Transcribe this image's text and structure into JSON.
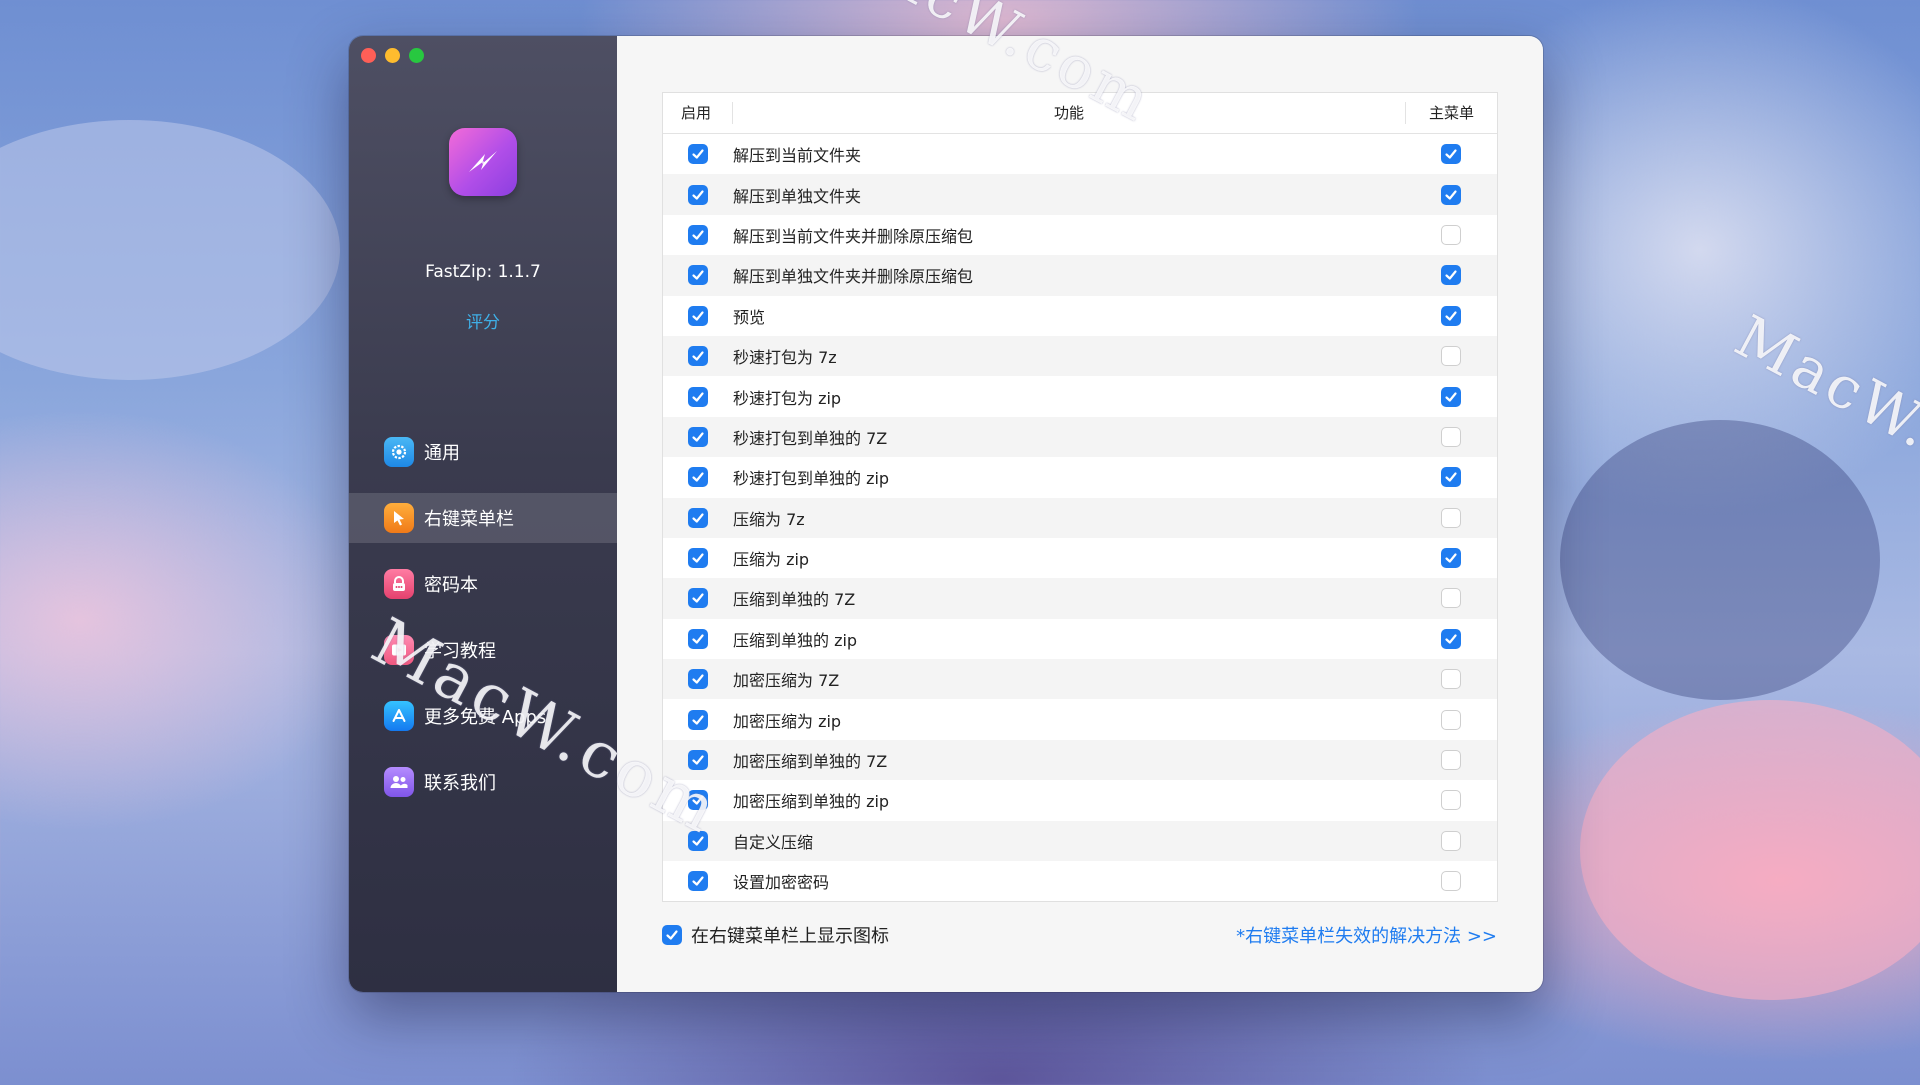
{
  "watermarks": [
    "MacW.com",
    "MacW.com",
    "MacW.com"
  ],
  "app": {
    "version": "FastZip: 1.1.7",
    "rate_label": "评分"
  },
  "nav": [
    {
      "label": "通用",
      "icon": "gear-icon",
      "active": false
    },
    {
      "label": "右键菜单栏",
      "icon": "cursor-icon",
      "active": true
    },
    {
      "label": "密码本",
      "icon": "lock-icon",
      "active": false
    },
    {
      "label": "学习教程",
      "icon": "play-icon",
      "active": false
    },
    {
      "label": "更多免费 Apps",
      "icon": "app-store-icon",
      "active": false
    },
    {
      "label": "联系我们",
      "icon": "contacts-icon",
      "active": false
    }
  ],
  "table": {
    "headers": {
      "enable": "启用",
      "function": "功能",
      "menu": "主菜单"
    },
    "rows": [
      {
        "label": "解压到当前文件夹",
        "enabled": true,
        "main_menu": true
      },
      {
        "label": "解压到单独文件夹",
        "enabled": true,
        "main_menu": true
      },
      {
        "label": "解压到当前文件夹并删除原压缩包",
        "enabled": true,
        "main_menu": false
      },
      {
        "label": "解压到单独文件夹并删除原压缩包",
        "enabled": true,
        "main_menu": true
      },
      {
        "label": "预览",
        "enabled": true,
        "main_menu": true
      },
      {
        "label": "秒速打包为 7z",
        "enabled": true,
        "main_menu": false
      },
      {
        "label": "秒速打包为 zip",
        "enabled": true,
        "main_menu": true
      },
      {
        "label": "秒速打包到单独的 7Z",
        "enabled": true,
        "main_menu": false
      },
      {
        "label": "秒速打包到单独的 zip",
        "enabled": true,
        "main_menu": true
      },
      {
        "label": "压缩为 7z",
        "enabled": true,
        "main_menu": false
      },
      {
        "label": "压缩为 zip",
        "enabled": true,
        "main_menu": true
      },
      {
        "label": "压缩到单独的 7Z",
        "enabled": true,
        "main_menu": false
      },
      {
        "label": "压缩到单独的 zip",
        "enabled": true,
        "main_menu": true
      },
      {
        "label": "加密压缩为 7Z",
        "enabled": true,
        "main_menu": false
      },
      {
        "label": "加密压缩为 zip",
        "enabled": true,
        "main_menu": false
      },
      {
        "label": "加密压缩到单独的 7Z",
        "enabled": true,
        "main_menu": false
      },
      {
        "label": "加密压缩到单独的 zip",
        "enabled": true,
        "main_menu": false
      },
      {
        "label": "自定义压缩",
        "enabled": true,
        "main_menu": false
      },
      {
        "label": "设置加密密码",
        "enabled": true,
        "main_menu": false
      }
    ]
  },
  "footer": {
    "show_icon_label": "在右键菜单栏上显示图标",
    "show_icon_checked": true,
    "help_link": "*右键菜单栏失效的解决方法 >>"
  },
  "colors": {
    "accent": "#1f7cf0",
    "link": "#3fb0e8"
  }
}
